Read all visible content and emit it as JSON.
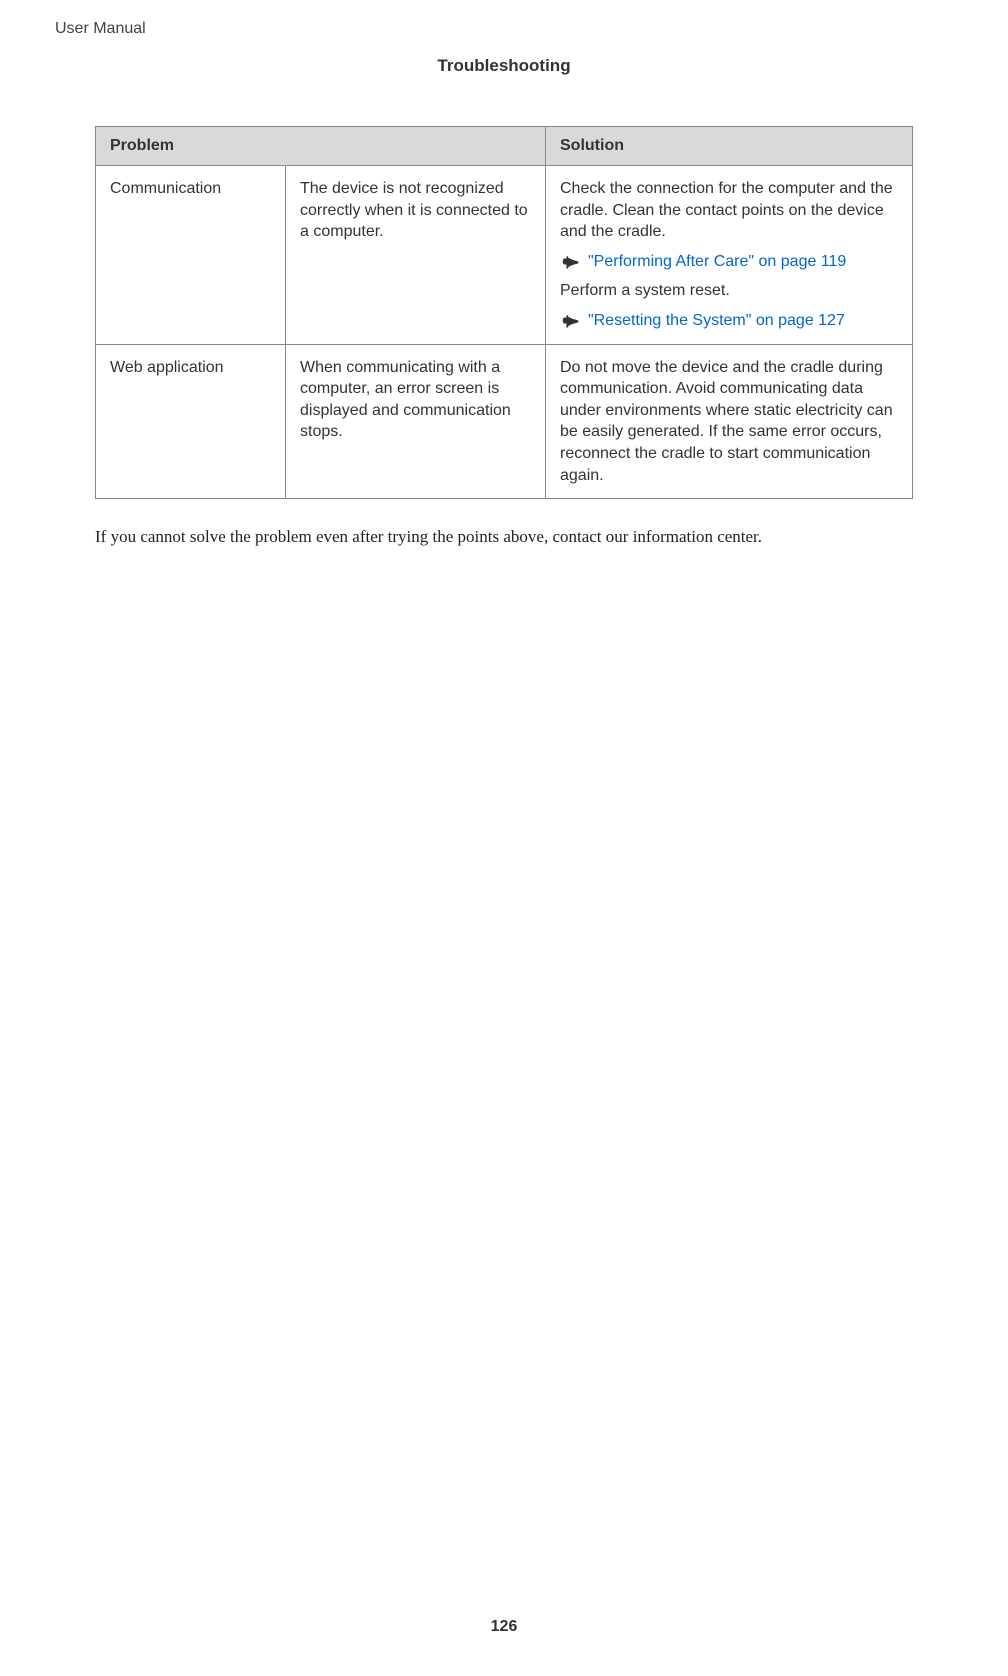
{
  "header": {
    "doc_title": "User Manual",
    "section_title": "Troubleshooting"
  },
  "table": {
    "headers": {
      "problem": "Problem",
      "solution": "Solution"
    },
    "rows": [
      {
        "category": "Communication",
        "description": "The device is not recognized correctly when it is connected to a computer.",
        "solution": {
          "text1": "Check the connection for the computer and the cradle. Clean the contact points on the device and the cradle.",
          "link1": "\"Performing After Care\" on page 119",
          "text2": "Perform a system reset.",
          "link2": "\"Resetting the System\" on page 127"
        }
      },
      {
        "category": "Web application",
        "description": "When communicating with a computer, an error screen is displayed and communication stops.",
        "solution": {
          "text1": "Do not move the device and the cradle during communication. Avoid communicating data under environments where static electricity can be easily generated. If the same error occurs, reconnect the cradle to start communication again."
        }
      }
    ]
  },
  "afternote": "If you cannot solve the problem even after trying the points above, contact our information center.",
  "page_number": "126"
}
